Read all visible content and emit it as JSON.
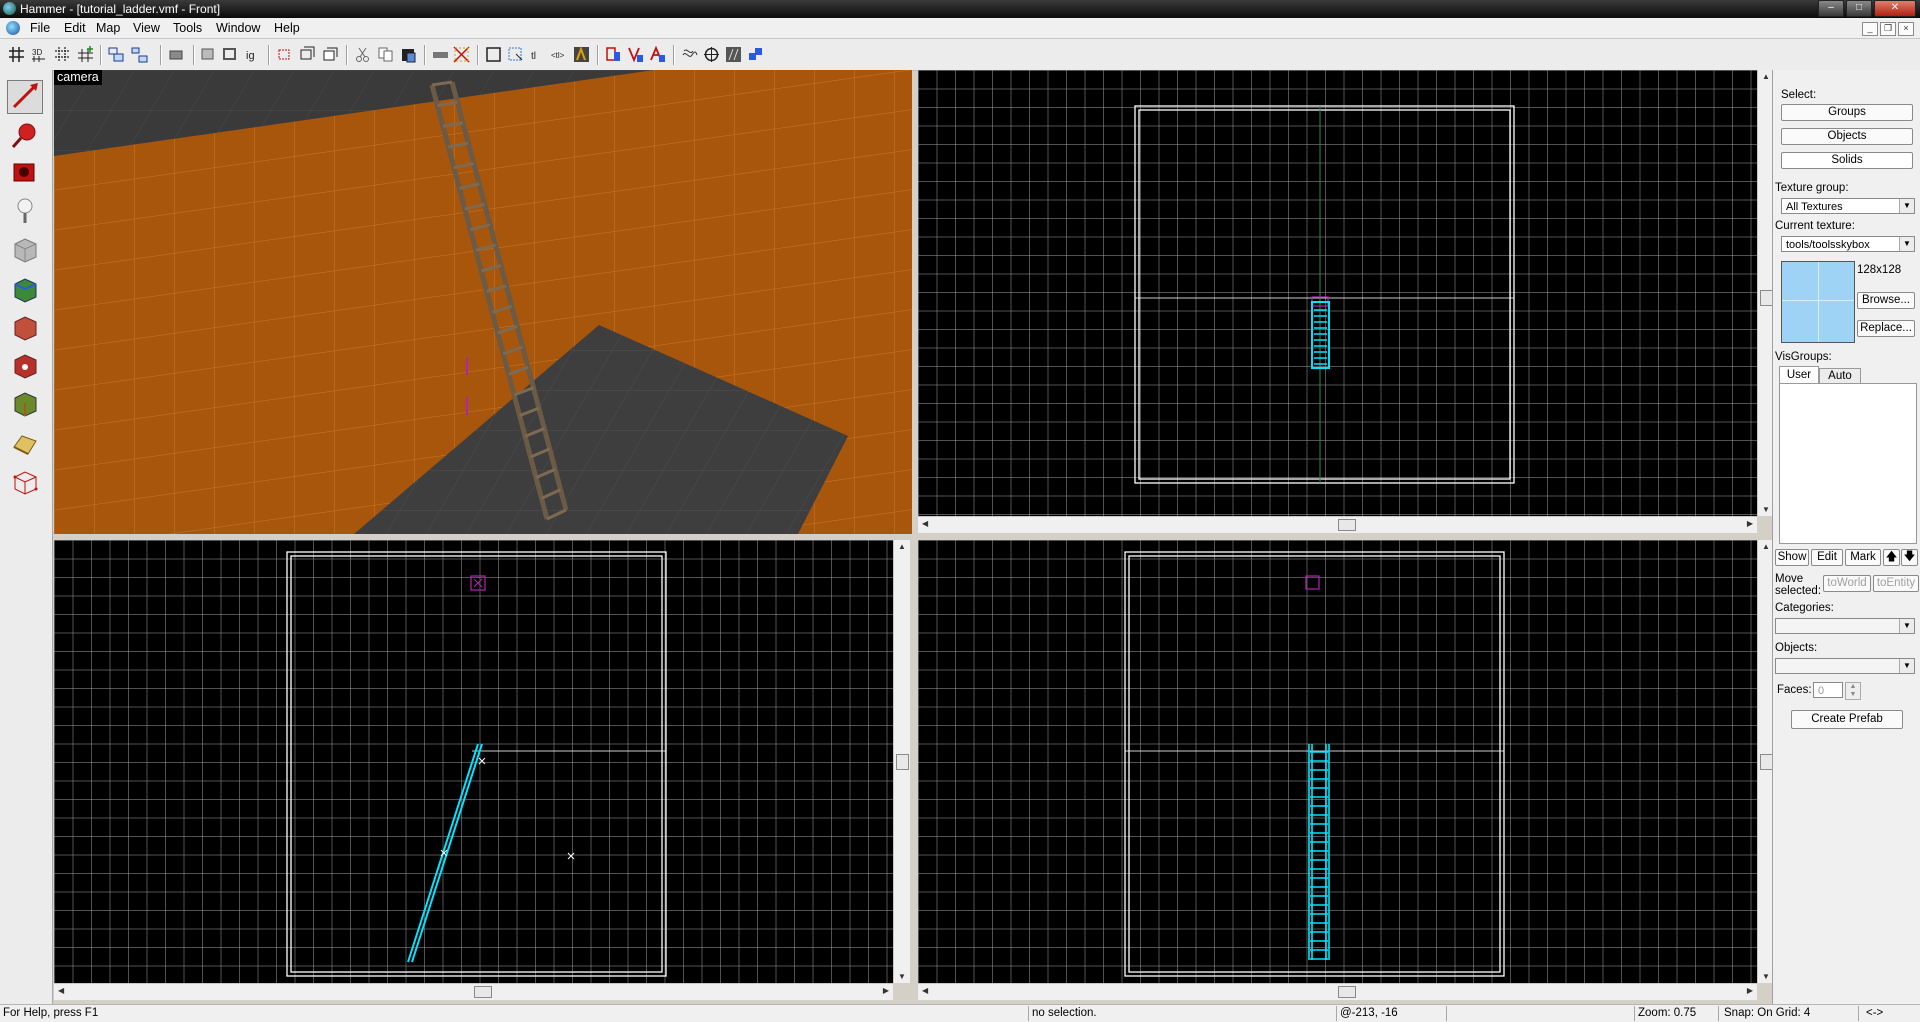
{
  "window": {
    "title": "Hammer - [tutorial_ladder.vmf - Front]",
    "controls": {
      "minimize": "–",
      "maximize": "□",
      "close": "✕"
    },
    "mdi_controls": {
      "minimize": "_",
      "restore": "❐",
      "close": "×"
    }
  },
  "menu": [
    "File",
    "Edit",
    "Map",
    "View",
    "Tools",
    "Window",
    "Help"
  ],
  "toolbar_icons": [
    "grid-icon",
    "3d-grid-icon",
    "dotted-grid-icon",
    "grid-plus-icon",
    "group-icon",
    "ungroup-icon",
    "hide-icon",
    "carve-icon",
    "hollow-icon",
    "ignore-groups-icon",
    "cordon-icon",
    "cordon-edit-icon",
    "cut-icon",
    "copy-icon",
    "paste-icon",
    "texture-lock-icon",
    "snap-icon",
    "selection-box-icon",
    "select-icon",
    "texture-scale-icon",
    "vertex-icon",
    "entity-icon",
    "check-icon",
    "flip-icon",
    "run-map-icon",
    "sound-icon",
    "radius-icon",
    "grid-toggle-icon",
    "link-icon"
  ],
  "left_tools": [
    "selection-tool-icon",
    "magnify-tool-icon",
    "camera-tool-icon",
    "entity-tool-icon",
    "block-tool-icon",
    "toggle-texture-app-icon",
    "apply-texture-icon",
    "apply-decal-icon",
    "overlay-tool-icon",
    "clipping-tool-icon",
    "vertex-tool-icon"
  ],
  "camera_view": {
    "label": "camera"
  },
  "right_panel": {
    "select_label": "Select:",
    "groups_button": "Groups",
    "objects_button": "Objects",
    "solids_button": "Solids",
    "texture_group_label": "Texture group:",
    "texture_group_value": "All Textures",
    "current_texture_label": "Current texture:",
    "current_texture_value": "tools/toolsskybox",
    "texture_size": "128x128",
    "browse_button": "Browse...",
    "replace_button": "Replace...",
    "visgroups_label": "VisGroups:",
    "tab_user": "User",
    "tab_auto": "Auto",
    "show_button": "Show",
    "edit_button": "Edit",
    "mark_button": "Mark",
    "move_selected_label": "Move selected:",
    "to_world_button": "toWorld",
    "to_entity_button": "toEntity",
    "categories_label": "Categories:",
    "objects_label": "Objects:",
    "faces_label": "Faces:",
    "faces_value": "0",
    "create_prefab_button": "Create Prefab"
  },
  "status": {
    "help": "For Help, press F1",
    "selection": "no selection.",
    "coords": "@-213, -16",
    "zoom": "Zoom: 0.75",
    "snap": "Snap: On Grid: 4",
    "extra": "<->"
  },
  "colors": {
    "brush_outline": "#ffffff",
    "selected_ladder": "#00e5ff",
    "entity_marker": "#b026b0",
    "grid_line": "#8a8a8a",
    "camera_wall": "#b05a10"
  }
}
